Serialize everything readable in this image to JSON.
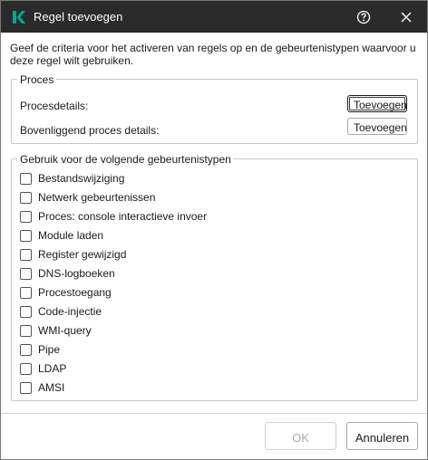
{
  "dialog": {
    "title": "Regel toevoegen",
    "description": "Geef de criteria voor het activeren van regels op en de gebeurtenistypen waarvoor u deze regel wilt gebruiken."
  },
  "process_group": {
    "legend": "Proces",
    "rows": [
      {
        "label": "Procesdetails:",
        "button": "Toevoegen"
      },
      {
        "label": "Bovenliggend proces details:",
        "button": "Toevoegen"
      }
    ]
  },
  "event_group": {
    "legend": "Gebruik voor de volgende gebeurtenistypen",
    "items": [
      {
        "label": "Bestandswijziging",
        "checked": false
      },
      {
        "label": "Netwerk gebeurtenissen",
        "checked": false
      },
      {
        "label": "Proces: console interactieve invoer",
        "checked": false
      },
      {
        "label": "Module laden",
        "checked": false
      },
      {
        "label": "Register gewijzigd",
        "checked": false
      },
      {
        "label": "DNS-logboeken",
        "checked": false
      },
      {
        "label": "Procestoegang",
        "checked": false
      },
      {
        "label": "Code-injectie",
        "checked": false
      },
      {
        "label": "WMI-query",
        "checked": false
      },
      {
        "label": "Pipe",
        "checked": false
      },
      {
        "label": "LDAP",
        "checked": false
      },
      {
        "label": "AMSI",
        "checked": false
      }
    ]
  },
  "footer": {
    "ok_label": "OK",
    "cancel_label": "Annuleren"
  },
  "colors": {
    "titlebar": "#2b2b2b",
    "brand": "#00a88e"
  }
}
